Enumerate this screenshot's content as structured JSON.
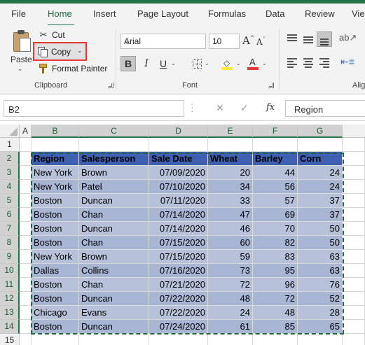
{
  "tabs": [
    "File",
    "Home",
    "Insert",
    "Page Layout",
    "Formulas",
    "Data",
    "Review",
    "Vie"
  ],
  "active_tab": "Home",
  "clipboard": {
    "paste_label": "Paste",
    "cut_label": "Cut",
    "copy_label": "Copy",
    "format_painter_label": "Format Painter",
    "group_label": "Clipboard"
  },
  "font": {
    "font_name": "Arial",
    "font_size": "10",
    "bold_label": "B",
    "italic_label": "I",
    "underline_label": "U",
    "group_label": "Font",
    "font_color": "#e53935",
    "highlight_color": "#ffeb3b"
  },
  "alignment": {
    "group_label": "Alig"
  },
  "formula_bar": {
    "name_box": "B2",
    "fx_label": "fx",
    "content": "Region"
  },
  "grid": {
    "columns": [
      "A",
      "B",
      "C",
      "D",
      "E",
      "F",
      "G"
    ],
    "rows": [
      "1",
      "2",
      "3",
      "4",
      "5",
      "6",
      "7",
      "8",
      "9",
      "10",
      "11",
      "12",
      "13",
      "14",
      "15"
    ],
    "selected_columns": [
      "B",
      "C",
      "D",
      "E",
      "F",
      "G"
    ],
    "header": [
      "Region",
      "Salesperson",
      "Sale Date",
      "Wheat",
      "Barley",
      "Corn"
    ],
    "data": [
      [
        "New York",
        "Brown",
        "07/09/2020",
        "20",
        "44",
        "24"
      ],
      [
        "New York",
        "Patel",
        "07/10/2020",
        "34",
        "56",
        "24"
      ],
      [
        "Boston",
        "Duncan",
        "07/11/2020",
        "33",
        "57",
        "37"
      ],
      [
        "Boston",
        "Chan",
        "07/14/2020",
        "47",
        "69",
        "37"
      ],
      [
        "Boston",
        "Duncan",
        "07/14/2020",
        "46",
        "70",
        "50"
      ],
      [
        "Boston",
        "Chan",
        "07/15/2020",
        "60",
        "82",
        "50"
      ],
      [
        "New York",
        "Brown",
        "07/15/2020",
        "59",
        "83",
        "63"
      ],
      [
        "Dallas",
        "Collins",
        "07/16/2020",
        "73",
        "95",
        "63"
      ],
      [
        "Boston",
        "Chan",
        "07/21/2020",
        "72",
        "96",
        "76"
      ],
      [
        "Boston",
        "Duncan",
        "07/22/2020",
        "48",
        "72",
        "52"
      ],
      [
        "Chicago",
        "Evans",
        "07/22/2020",
        "24",
        "48",
        "28"
      ],
      [
        "Boston",
        "Duncan",
        "07/24/2020",
        "61",
        "85",
        "65"
      ]
    ],
    "colors": {
      "header_fill": "#3f5fb0",
      "data_fill": "#b7c1d9",
      "accent": "#217346"
    }
  }
}
